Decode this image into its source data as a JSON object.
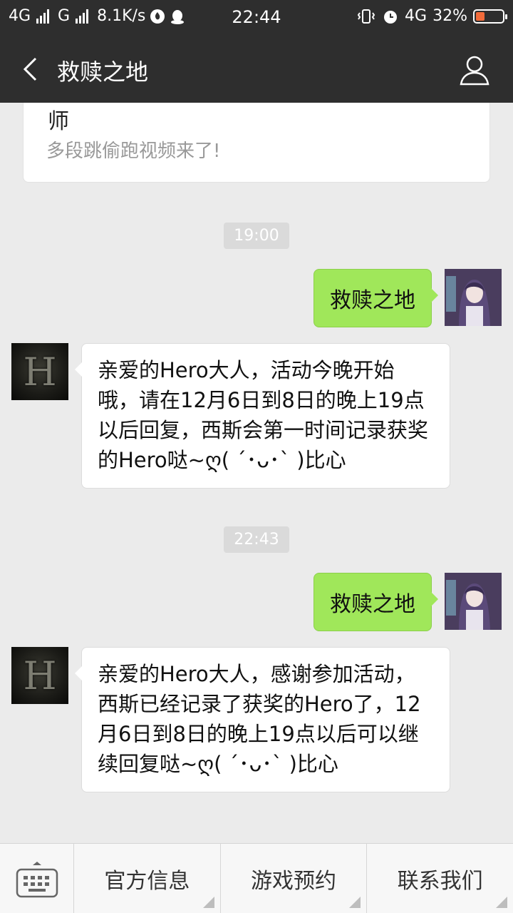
{
  "status_bar": {
    "net1": "4G",
    "net2": "G",
    "speed": "8.1K/s",
    "time": "22:44",
    "net3": "4G",
    "battery": "32%",
    "battery_level": 0.32
  },
  "header": {
    "title": "救赎之地"
  },
  "card": {
    "title": "师",
    "desc": "多段跳偷跑视频来了!"
  },
  "messages": [
    {
      "type": "time",
      "text": "19:00"
    },
    {
      "type": "out",
      "text": "救赎之地"
    },
    {
      "type": "in",
      "text": "亲爱的Hero大人，活动今晚开始哦，请在12月6日到8日的晚上19点以后回复，西斯会第一时间记录获奖的Hero哒~ღ( ´･ᴗ･` )比心"
    },
    {
      "type": "time",
      "text": "22:43"
    },
    {
      "type": "out",
      "text": "救赎之地"
    },
    {
      "type": "in",
      "text": "亲爱的Hero大人，感谢参加活动，西斯已经记录了获奖的Hero了，12月6日到8日的晚上19点以后可以继续回复哒~ღ( ´･ᴗ･` )比心"
    }
  ],
  "avatar_letter": "H",
  "menu": {
    "items": [
      "官方信息",
      "游戏预约",
      "联系我们"
    ]
  },
  "colors": {
    "header_bg": "#2e2e2e",
    "outgoing_bubble": "#a0e75a",
    "chat_bg": "#ebebeb"
  }
}
